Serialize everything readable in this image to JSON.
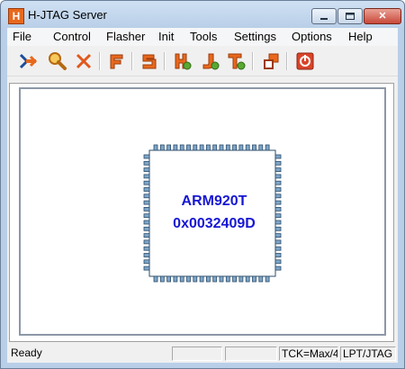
{
  "window": {
    "title": "H-JTAG Server",
    "icon_letter": "H",
    "controls": {
      "minimize_icon": "minimize-icon",
      "maximize_icon": "maximize-icon",
      "close_label": "✕"
    }
  },
  "menu": [
    {
      "label": "File"
    },
    {
      "label": "Control"
    },
    {
      "label": "Flasher"
    },
    {
      "label": "Init"
    },
    {
      "label": "Tools"
    },
    {
      "label": "Settings"
    },
    {
      "label": "Options"
    },
    {
      "label": "Help"
    }
  ],
  "toolbar": {
    "buttons": [
      {
        "icon": "detect-target-icon"
      },
      {
        "icon": "search-icon"
      },
      {
        "icon": "close-icon"
      },
      {
        "icon": "flasher-icon"
      },
      {
        "icon": "script-icon"
      },
      {
        "icon": "h-tool-icon"
      },
      {
        "icon": "j-tool-icon"
      },
      {
        "icon": "t-tool-icon"
      },
      {
        "icon": "window-icon"
      },
      {
        "icon": "power-icon"
      }
    ]
  },
  "target": {
    "cpu": "ARM920T",
    "id": "0x0032409D"
  },
  "status": {
    "message": "Ready",
    "pane2": "",
    "pane3": "",
    "tck": "TCK=Max/4",
    "interface": "LPT/JTAG"
  },
  "colors": {
    "chip_text": "#1717d4",
    "pin_fill": "#7fa6c8",
    "accent_orange": "#e8681d"
  }
}
